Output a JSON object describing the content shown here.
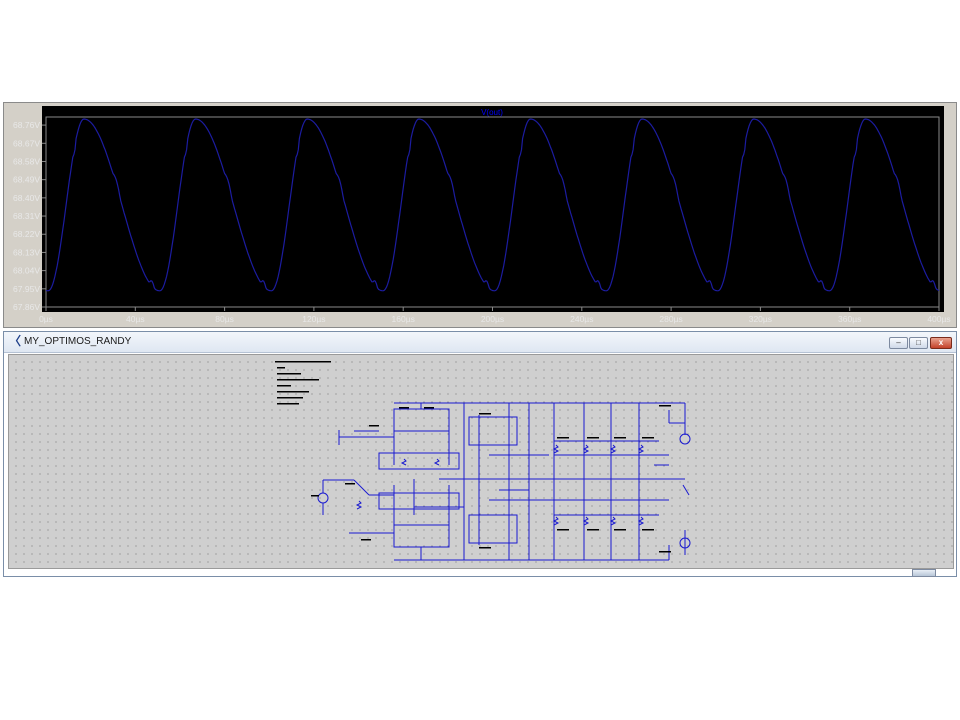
{
  "plot": {
    "trace_name": "V(out)",
    "y_ticks": [
      "68.76V",
      "68.67V",
      "68.58V",
      "68.49V",
      "68.40V",
      "68.31V",
      "68.22V",
      "68.13V",
      "68.04V",
      "67.95V",
      "67.86V"
    ],
    "x_ticks": [
      "0µs",
      "40µs",
      "80µs",
      "120µs",
      "160µs",
      "200µs",
      "240µs",
      "280µs",
      "320µs",
      "360µs",
      "400µs"
    ],
    "colors": {
      "background": "#000000",
      "trace": "#1c1ca0",
      "label": "#0000ff",
      "axis_text": "#e8e8e8"
    }
  },
  "chart_data": {
    "type": "line",
    "title": "V(out)",
    "xlabel": "",
    "ylabel": "",
    "xlim": [
      0,
      400
    ],
    "ylim": [
      67.86,
      68.8
    ],
    "x_unit": "µs",
    "y_unit": "V",
    "series": [
      {
        "name": "V(out)",
        "period_us": 50,
        "first_min_us": 1,
        "first_max_us": 17,
        "min_value": 67.94,
        "max_value": 68.79
      }
    ],
    "grid": false
  },
  "schematic_window": {
    "title": "MY_OPTIMOS_RANDY",
    "buttons": {
      "minimize": "–",
      "maximize": "□",
      "close": "x"
    },
    "app_icon": "ltspice-icon"
  }
}
